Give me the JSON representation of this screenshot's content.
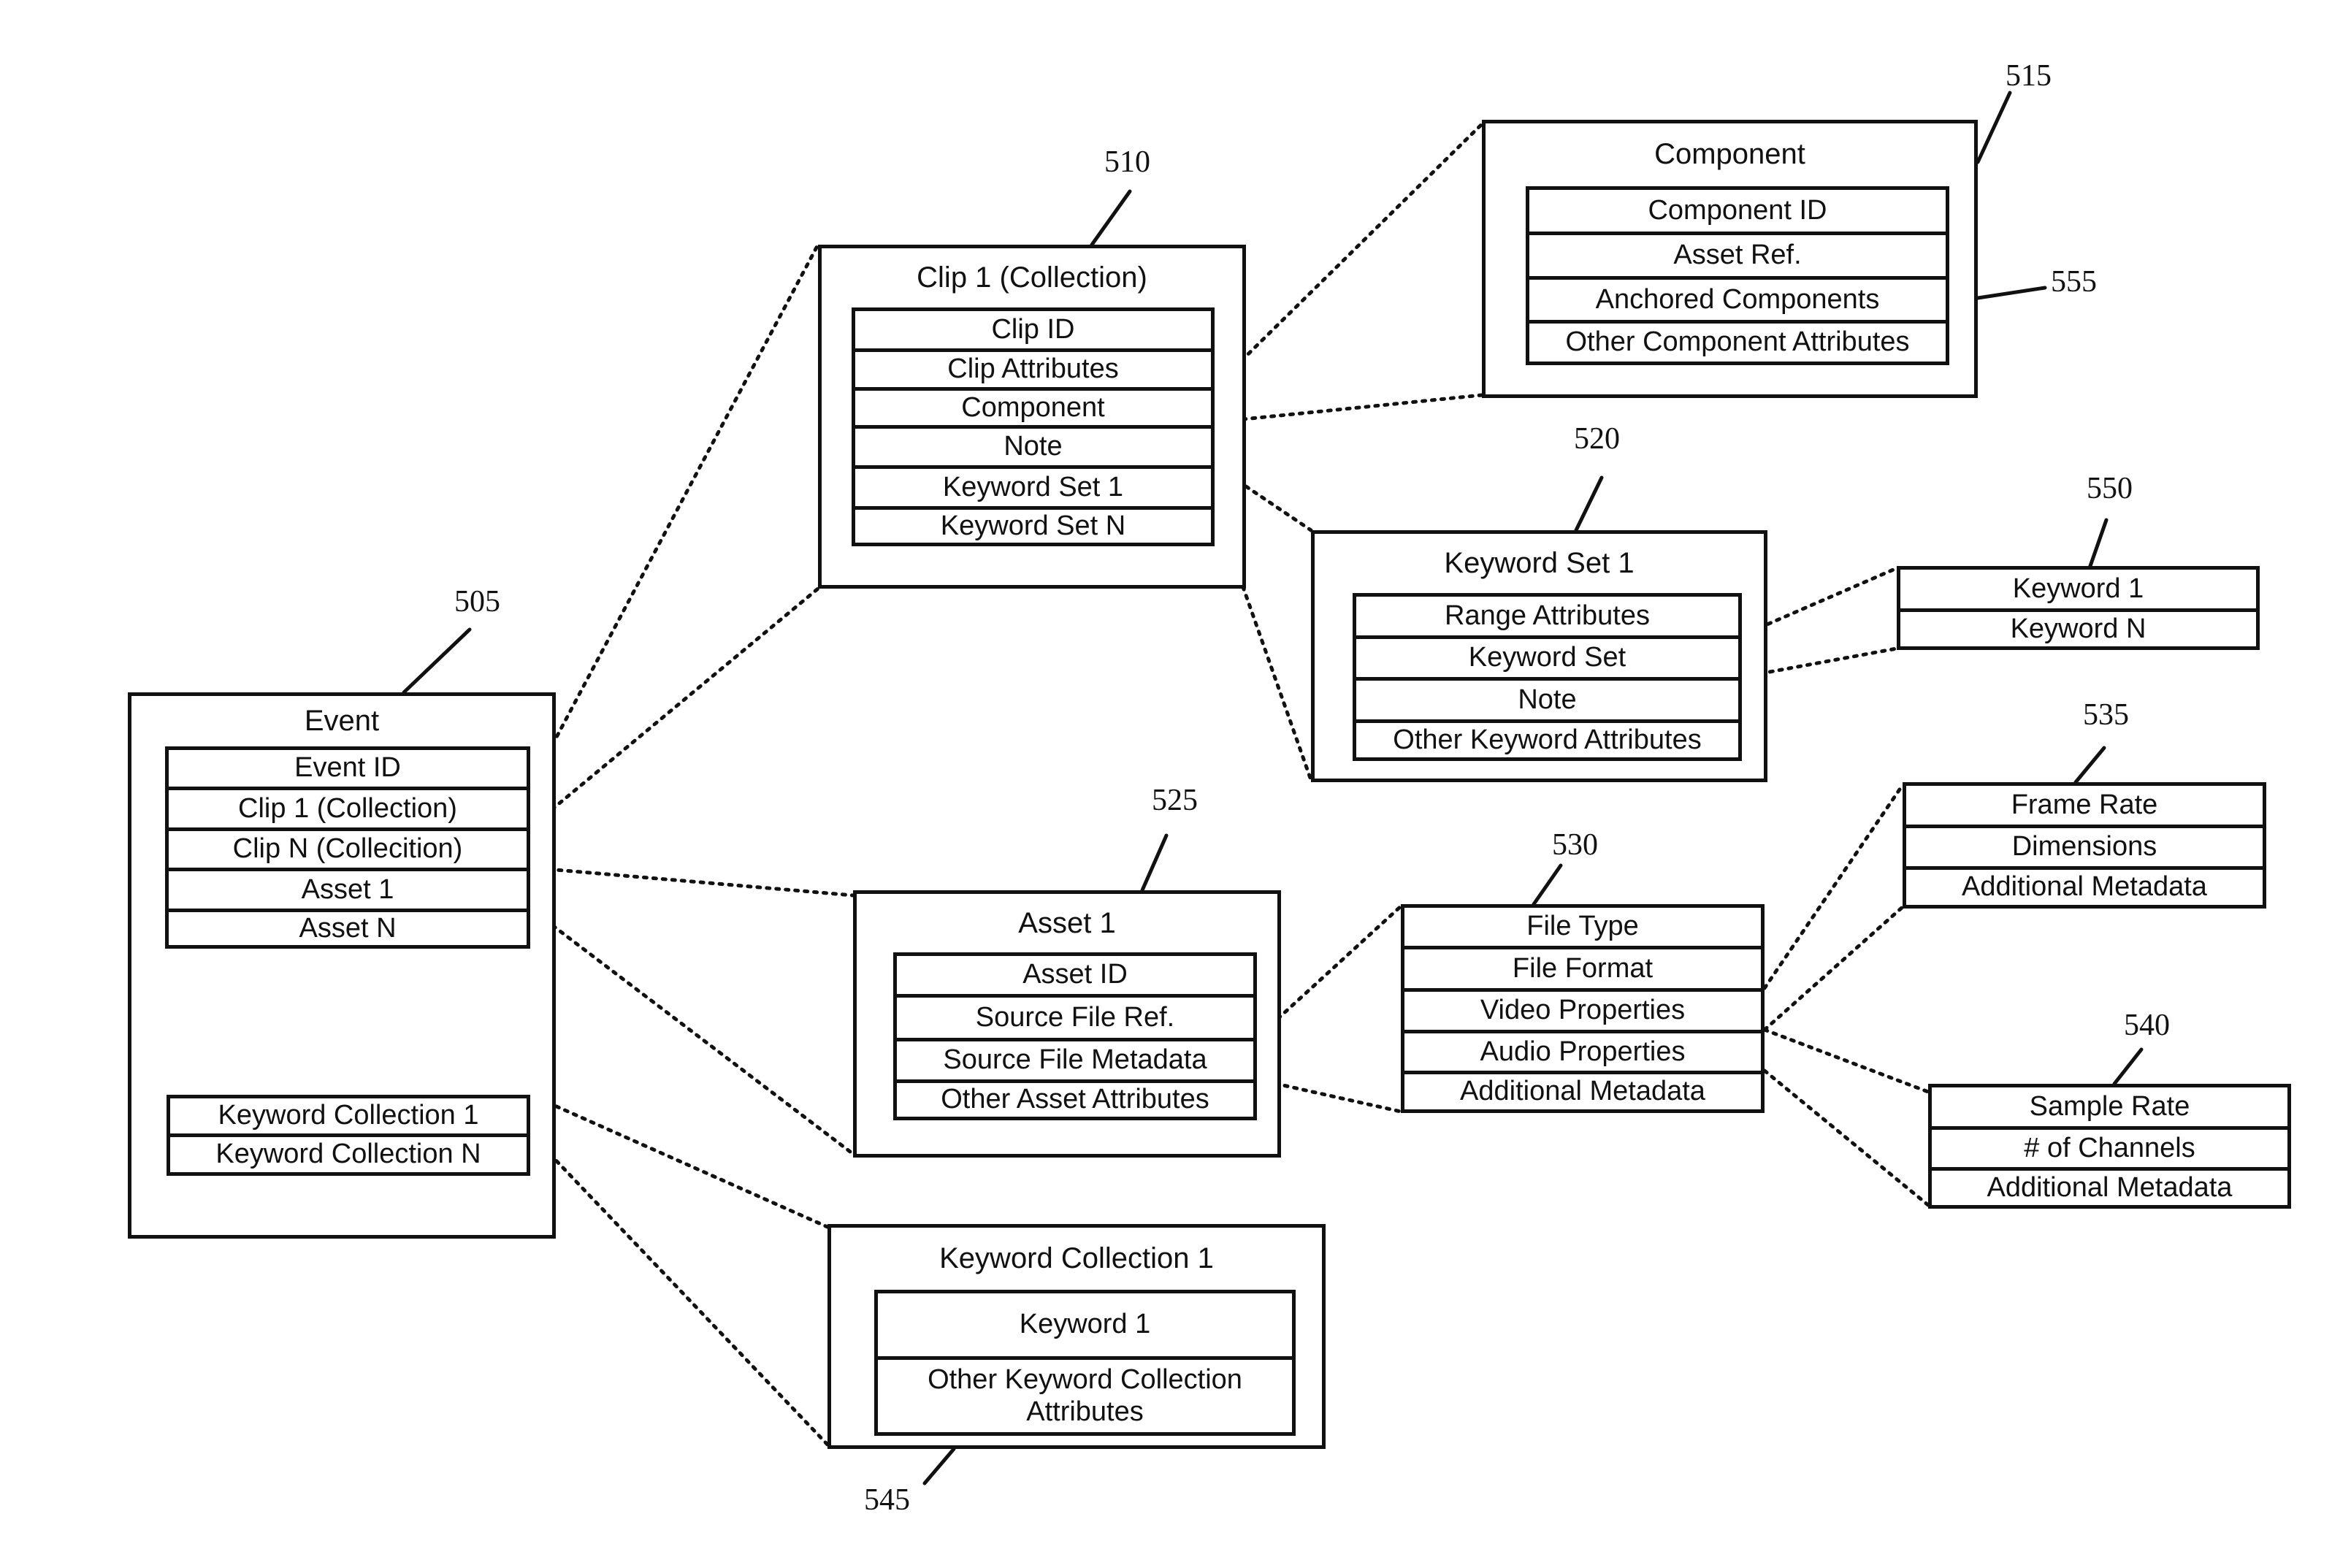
{
  "figure": {
    "event": {
      "ref": "505",
      "title": "Event",
      "fields": [
        "Event ID",
        "Clip 1 (Collection)",
        "Clip N (Collecition)",
        "Asset 1",
        "Asset N"
      ],
      "keyword_collections": [
        "Keyword Collection 1",
        "Keyword Collection N"
      ]
    },
    "clip": {
      "ref": "510",
      "title": "Clip 1 (Collection)",
      "fields": [
        "Clip ID",
        "Clip Attributes",
        "Component",
        "Note",
        "Keyword Set 1",
        "Keyword Set N"
      ]
    },
    "component": {
      "ref": "515",
      "title": "Component",
      "fields": [
        "Component ID",
        "Asset Ref.",
        "Anchored Components",
        "Other Component Attributes"
      ],
      "anchored_ref": "555"
    },
    "keyword_set": {
      "ref": "520",
      "title": "Keyword Set 1",
      "fields": [
        "Range Attributes",
        "Keyword Set",
        "Note",
        "Other Keyword Attributes"
      ]
    },
    "keywords": {
      "ref": "550",
      "fields": [
        "Keyword 1",
        "Keyword N"
      ]
    },
    "asset": {
      "ref": "525",
      "title": "Asset 1",
      "fields": [
        "Asset ID",
        "Source File Ref.",
        "Source File Metadata",
        "Other Asset Attributes"
      ]
    },
    "source_metadata": {
      "ref": "530",
      "fields": [
        "File Type",
        "File Format",
        "Video Properties",
        "Audio Properties",
        "Additional Metadata"
      ]
    },
    "video_properties": {
      "ref": "535",
      "fields": [
        "Frame Rate",
        "Dimensions",
        "Additional Metadata"
      ]
    },
    "audio_properties": {
      "ref": "540",
      "fields": [
        "Sample Rate",
        "# of Channels",
        "Additional Metadata"
      ]
    },
    "keyword_collection": {
      "ref": "545",
      "title": "Keyword Collection 1",
      "fields": [
        "Keyword 1",
        "Other Keyword Collection Attributes"
      ]
    }
  }
}
